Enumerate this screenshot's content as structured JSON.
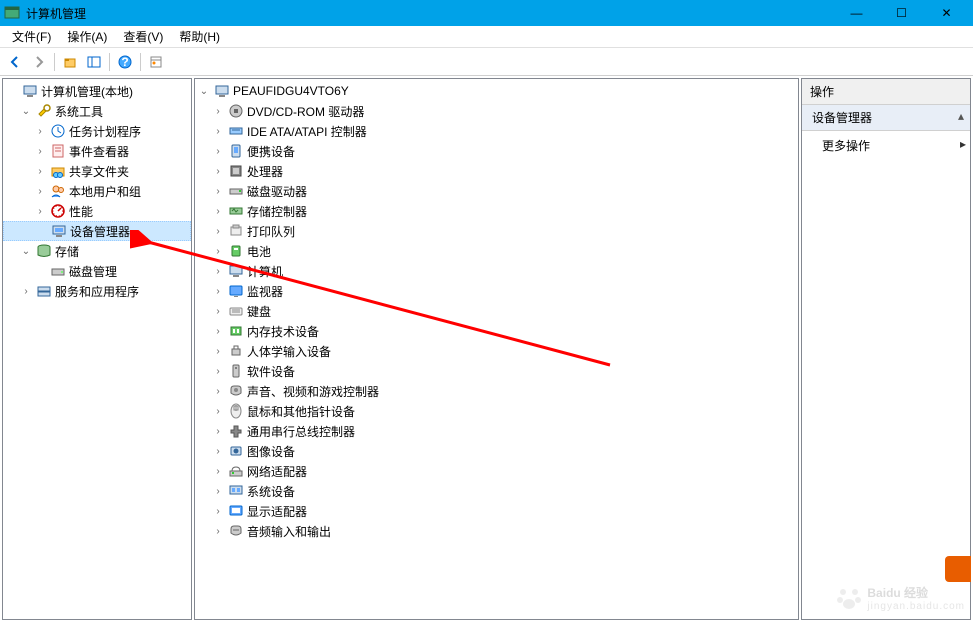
{
  "window": {
    "title": "计算机管理",
    "min": "—",
    "max": "☐",
    "close": "✕"
  },
  "menu": {
    "file": "文件(F)",
    "action": "操作(A)",
    "view": "查看(V)",
    "help": "帮助(H)"
  },
  "left_tree": {
    "root": "计算机管理(本地)",
    "system_tools": "系统工具",
    "task_scheduler": "任务计划程序",
    "event_viewer": "事件查看器",
    "shared_folders": "共享文件夹",
    "local_users": "本地用户和组",
    "performance": "性能",
    "device_manager": "设备管理器",
    "storage": "存储",
    "disk_management": "磁盘管理",
    "services_apps": "服务和应用程序"
  },
  "device_tree": {
    "root": "PEAUFIDGU4VTO6Y",
    "items": [
      "DVD/CD-ROM 驱动器",
      "IDE ATA/ATAPI 控制器",
      "便携设备",
      "处理器",
      "磁盘驱动器",
      "存储控制器",
      "打印队列",
      "电池",
      "计算机",
      "监视器",
      "键盘",
      "内存技术设备",
      "人体学输入设备",
      "软件设备",
      "声音、视频和游戏控制器",
      "鼠标和其他指针设备",
      "通用串行总线控制器",
      "图像设备",
      "网络适配器",
      "系统设备",
      "显示适配器",
      "音频输入和输出"
    ]
  },
  "actions": {
    "header": "操作",
    "section": "设备管理器",
    "more": "更多操作"
  },
  "watermark": {
    "brand": "Baidu 经验",
    "sub": "jingyan.baidu.com"
  }
}
